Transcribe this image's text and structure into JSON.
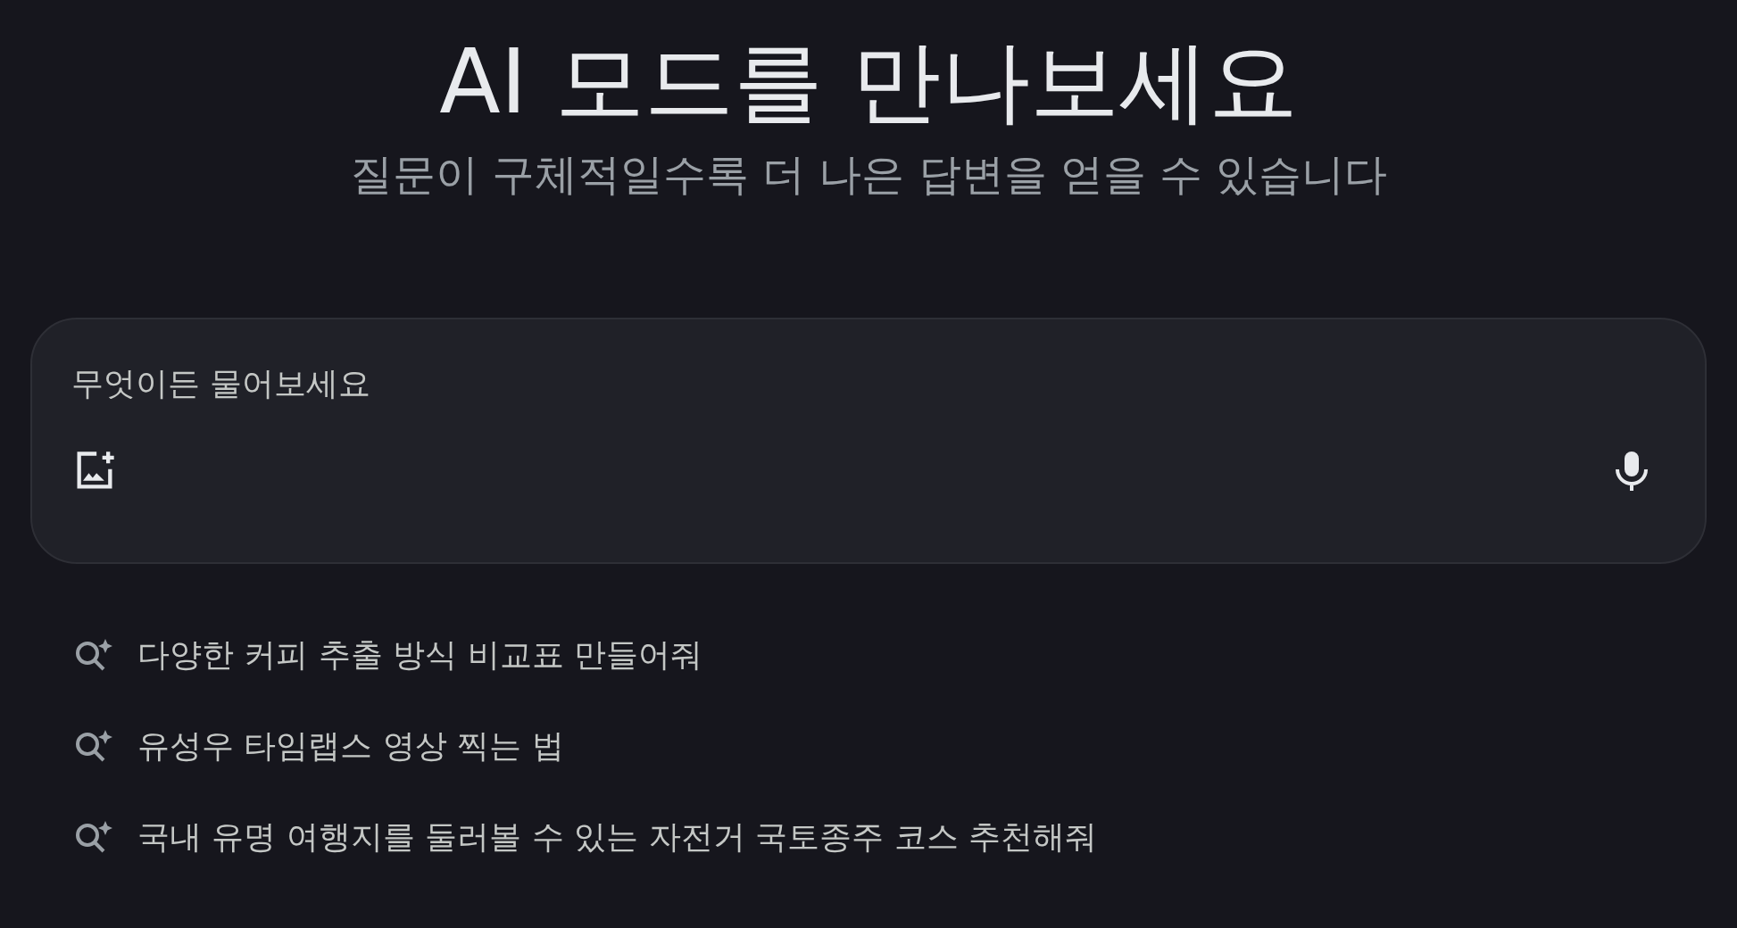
{
  "title": "AI 모드를 만나보세요",
  "subtitle": "질문이 구체적일수록 더 나은 답변을 얻을 수 있습니다",
  "search": {
    "placeholder": "무엇이든 물어보세요"
  },
  "suggestions": [
    {
      "text": "다양한 커피 추출 방식 비교표 만들어줘"
    },
    {
      "text": "유성우 타임랩스 영상 찍는 법"
    },
    {
      "text": "국내 유명 여행지를 둘러볼 수 있는 자전거 국토종주 코스 추천해줘"
    }
  ]
}
